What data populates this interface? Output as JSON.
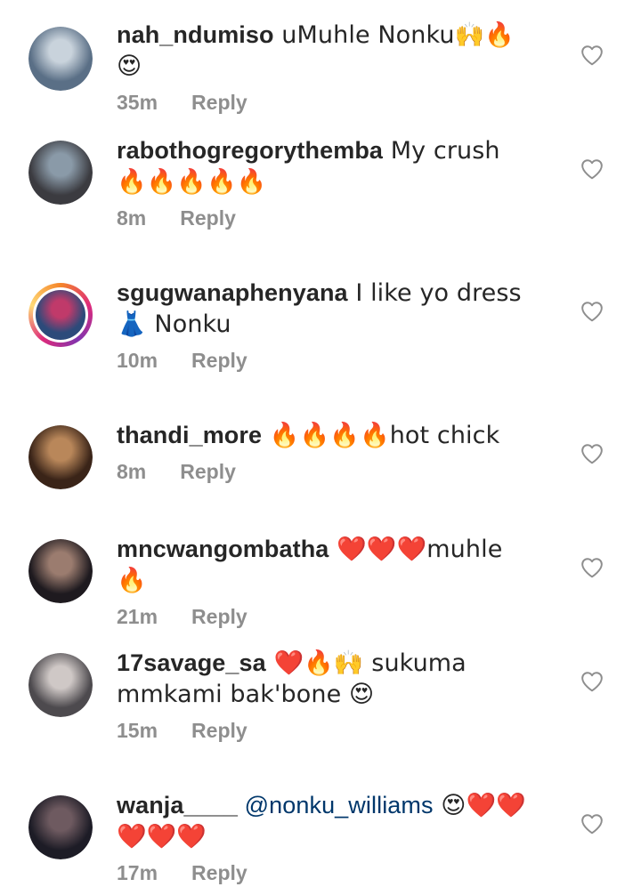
{
  "comments": [
    {
      "username": "nah_ndumiso",
      "text": " uMuhle  Nonku🙌🔥😍",
      "time": "35m",
      "reply": "Reply",
      "story": false,
      "avatar_colors": [
        "#5a6f86",
        "#c9d3dc"
      ]
    },
    {
      "username": "rabothogregorythemba",
      "text": " My crush 🔥🔥🔥🔥🔥",
      "time": "8m",
      "reply": "Reply",
      "story": false,
      "avatar_colors": [
        "#3b3b40",
        "#8a9aa8"
      ]
    },
    {
      "username": "sgugwanaphenyana",
      "text": " I like yo dress 👗 Nonku",
      "time": "10m",
      "reply": "Reply",
      "story": true,
      "avatar_colors": [
        "#2c4a7a",
        "#c03a6a"
      ]
    },
    {
      "username": "thandi_more",
      "text": " 🔥🔥🔥🔥hot chick",
      "time": "8m",
      "reply": "Reply",
      "story": false,
      "avatar_colors": [
        "#3a2418",
        "#b9875a"
      ]
    },
    {
      "username": "mncwangombatha",
      "text": " ❤️❤️❤️muhle 🔥",
      "time": "21m",
      "reply": "Reply",
      "story": false,
      "avatar_colors": [
        "#1e1a1f",
        "#9b7c6f"
      ]
    },
    {
      "username": "17savage_sa",
      "text": " ❤️🔥🙌 sukuma mmkami bak'bone 😍",
      "time": "15m",
      "reply": "Reply",
      "story": false,
      "avatar_colors": [
        "#4d4a4e",
        "#cfc8c6"
      ]
    },
    {
      "username": "wanja____",
      "mention": "@nonku_williams",
      "text": " 😍❤️❤️❤️❤️❤️",
      "time": "17m",
      "reply": "Reply",
      "story": false,
      "avatar_colors": [
        "#1d1c26",
        "#6e5a60"
      ]
    }
  ]
}
